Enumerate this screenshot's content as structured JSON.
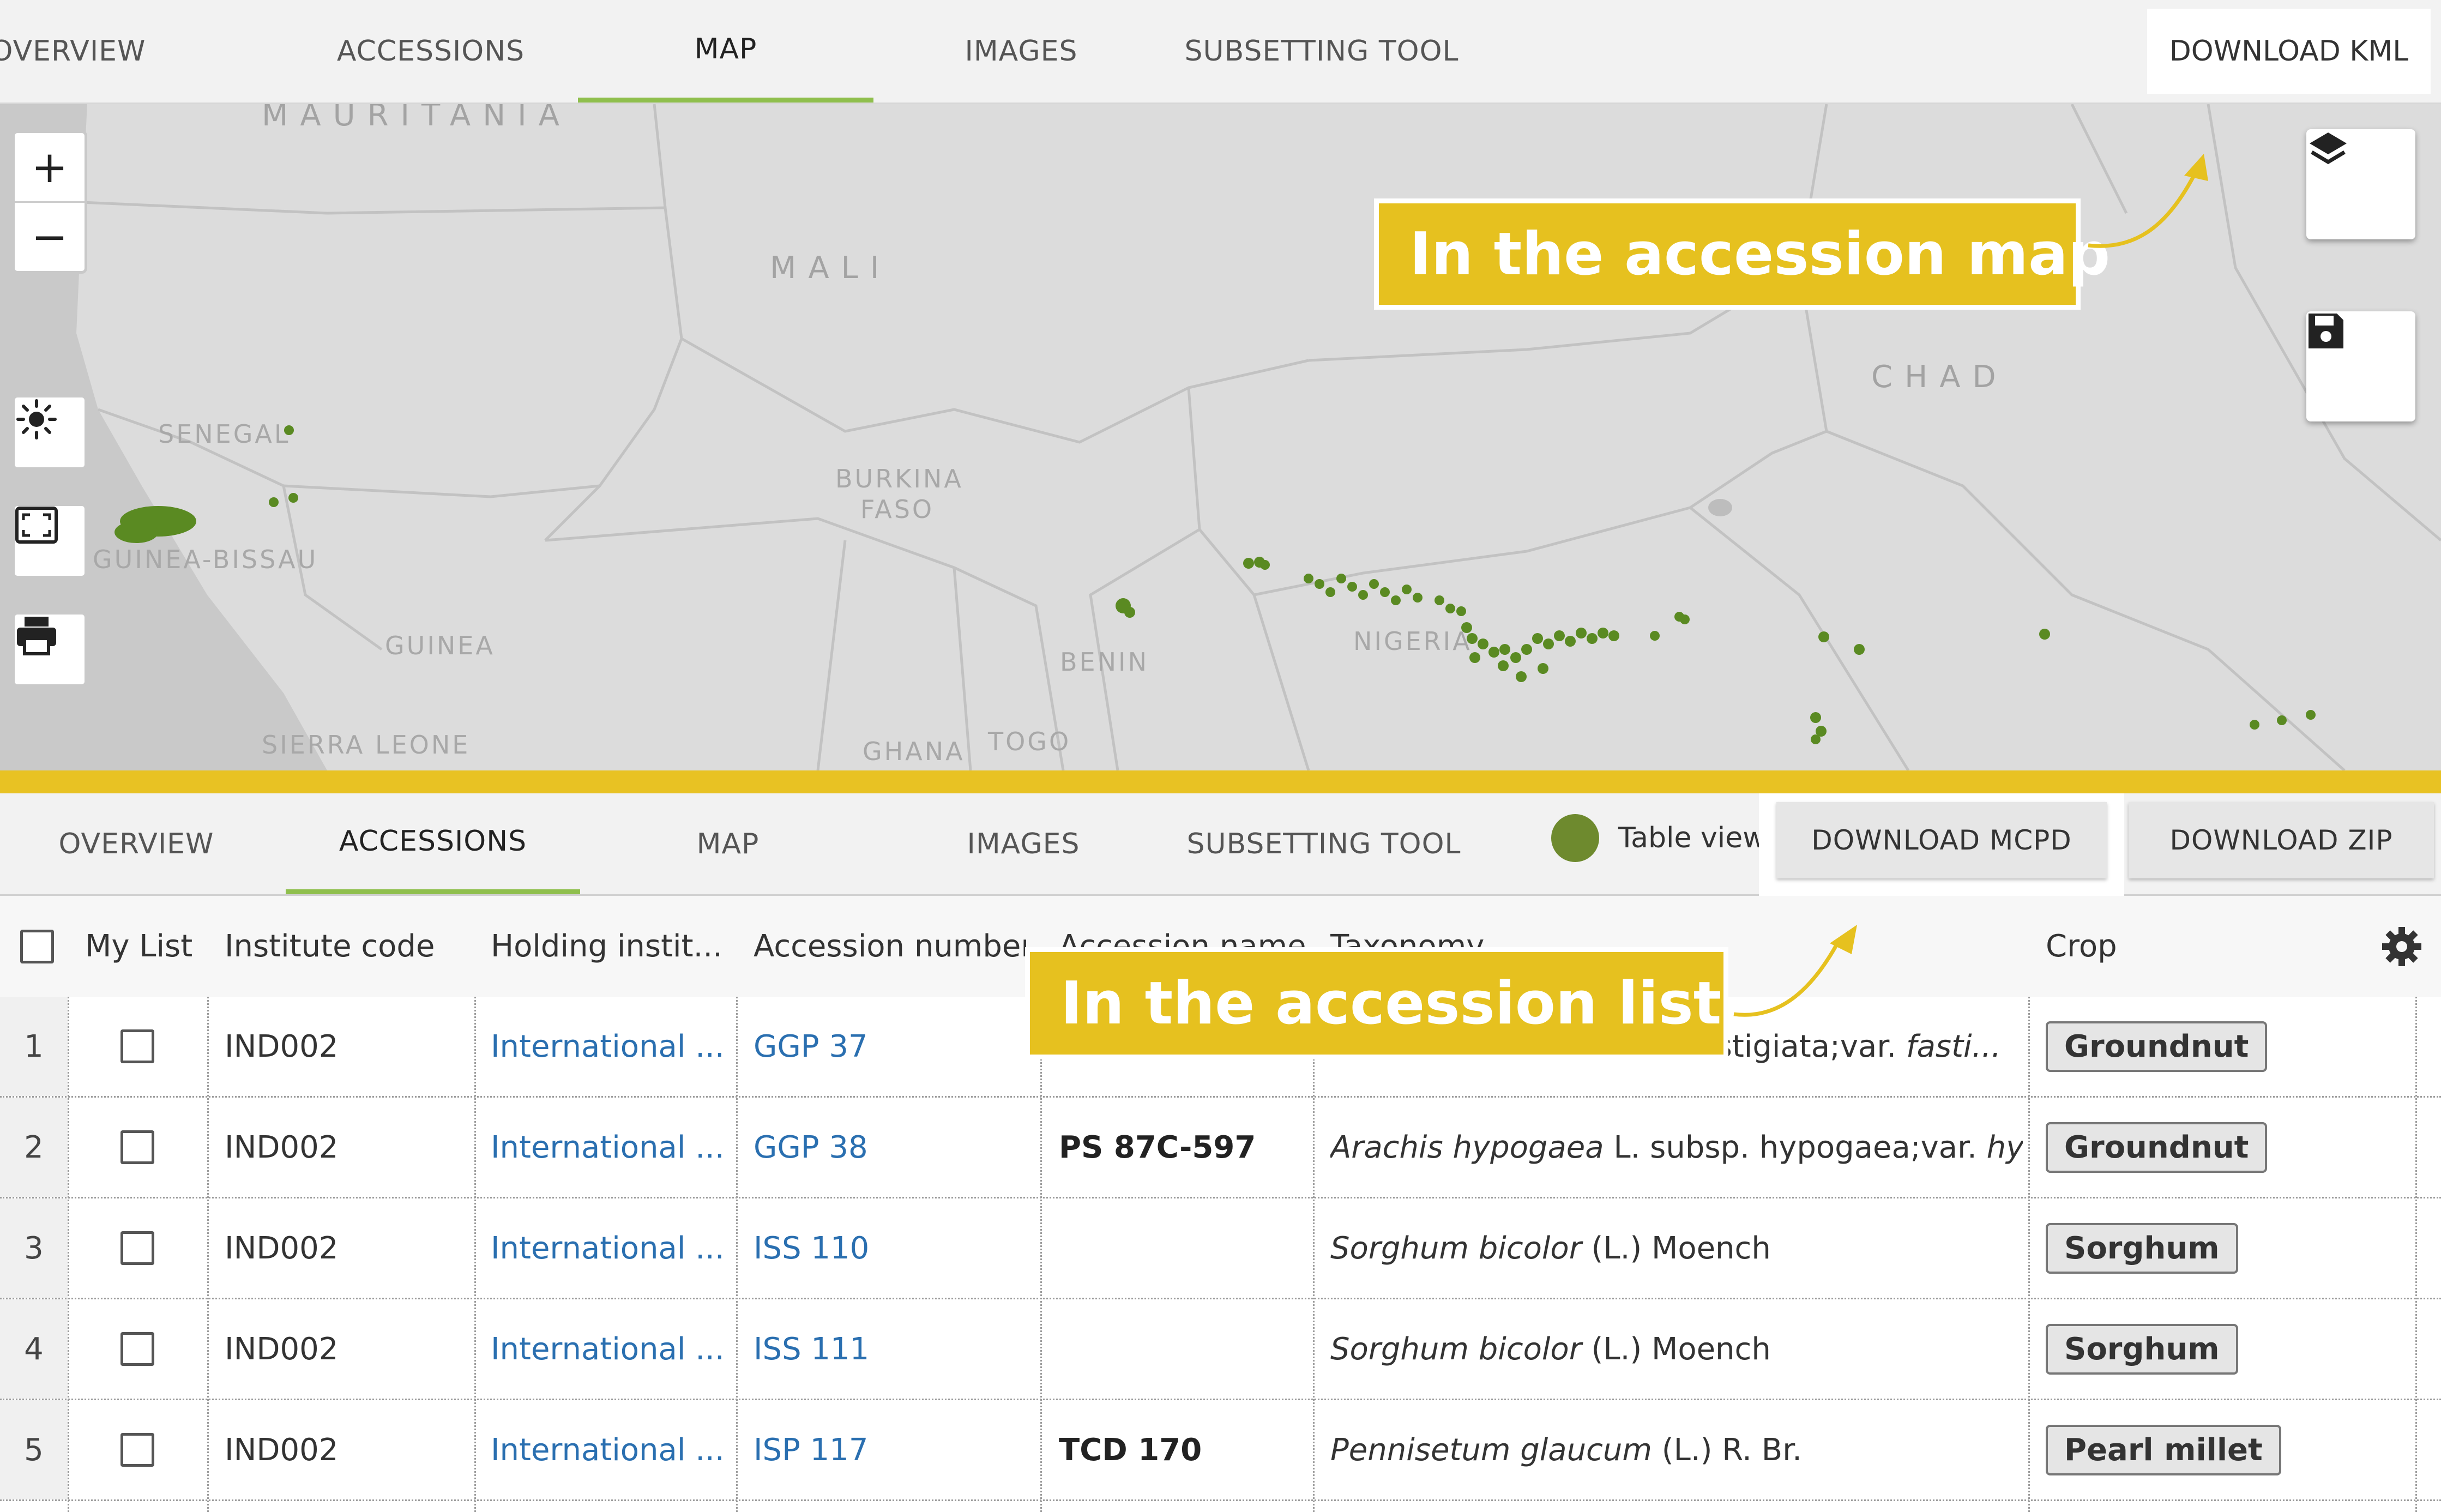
{
  "top_tabs": {
    "overview": "OVERVIEW",
    "accessions": "ACCESSIONS",
    "map": "MAP",
    "images": "IMAGES",
    "subsetting": "SUBSETTING TOOL",
    "download_kml": "DOWNLOAD KML",
    "active": "MAP"
  },
  "map": {
    "zoom_in": "+",
    "zoom_out": "−",
    "labels": {
      "mauritania": "MAURITANIA",
      "mali": "MALI",
      "chad": "CHAD",
      "senegal": "SENEGAL",
      "guinea_bissau": "GUINEA-BISSAU",
      "burkina_faso_1": "BURKINA",
      "burkina_faso_2": "FASO",
      "guinea": "GUINEA",
      "benin": "BENIN",
      "nigeria": "NIGERIA",
      "sierra_leone": "SIERRA LEONE",
      "ghana": "GHANA",
      "togo": "TOGO"
    },
    "icons": [
      "plus-icon",
      "minus-icon",
      "sun-icon",
      "fullscreen-icon",
      "print-icon",
      "layers-icon",
      "save-icon"
    ],
    "marker_color": "#5a8a22"
  },
  "bottom_tabs": {
    "overview": "OVERVIEW",
    "accessions": "ACCESSIONS",
    "map": "MAP",
    "images": "IMAGES",
    "subsetting": "SUBSETTING TOOL",
    "table_view_label": "Table view",
    "download_mcpd": "DOWNLOAD MCPD",
    "download_zip": "DOWNLOAD ZIP",
    "active": "ACCESSIONS"
  },
  "table": {
    "columns": {
      "my_list": "My List",
      "institute_code": "Institute code",
      "holding_institute": "Holding instit...",
      "accession_number": "Accession number",
      "accession_name": "Accession name",
      "taxonomy": "Taxonomy",
      "crop": "Crop"
    },
    "rows": [
      {
        "num": "1",
        "institute_code": "IND002",
        "holding": "International ...",
        "accession_number": "GGP 37",
        "accession_name": "",
        "taxonomy_prefix": "",
        "taxonomy_rest": "fastigiata;var.",
        "taxonomy_italic2": "fasti...",
        "crop": "Groundnut"
      },
      {
        "num": "2",
        "institute_code": "IND002",
        "holding": "International ...",
        "accession_number": "GGP 38",
        "accession_name": "PS 87C-597",
        "taxonomy_prefix": "Arachis hypogaea",
        "taxonomy_rest": "L. subsp. hypogaea;var.",
        "taxonomy_italic2": "hyp...",
        "crop": "Groundnut"
      },
      {
        "num": "3",
        "institute_code": "IND002",
        "holding": "International ...",
        "accession_number": "ISS 110",
        "accession_name": "",
        "taxonomy_prefix": "Sorghum bicolor",
        "taxonomy_rest": "(L.) Moench",
        "taxonomy_italic2": "",
        "crop": "Sorghum"
      },
      {
        "num": "4",
        "institute_code": "IND002",
        "holding": "International ...",
        "accession_number": "ISS 111",
        "accession_name": "",
        "taxonomy_prefix": "Sorghum bicolor",
        "taxonomy_rest": "(L.) Moench",
        "taxonomy_italic2": "",
        "crop": "Sorghum"
      },
      {
        "num": "5",
        "institute_code": "IND002",
        "holding": "International ...",
        "accession_number": "ISP 117",
        "accession_name": "TCD 170",
        "taxonomy_prefix": "Pennisetum glaucum",
        "taxonomy_rest": "(L.) R. Br.",
        "taxonomy_italic2": "",
        "crop": "Pearl millet"
      }
    ]
  },
  "callouts": {
    "map": "In the accession map",
    "list": "In the accession list"
  },
  "colors": {
    "accent_green": "#8fbf4d",
    "callout_yellow": "#e6c11f",
    "link_blue": "#2a6fb0"
  }
}
